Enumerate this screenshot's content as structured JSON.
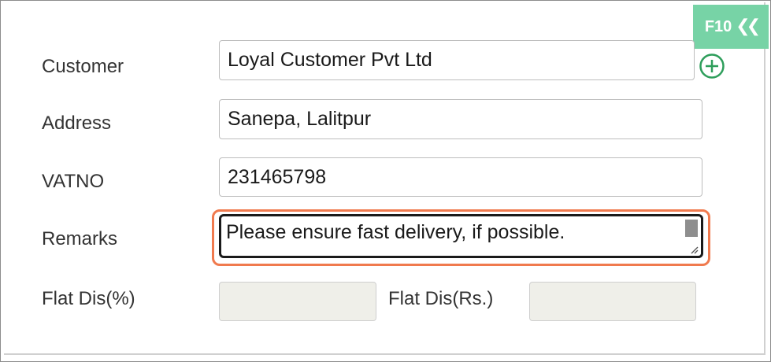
{
  "shortcut": {
    "label": "F10",
    "icon": "double-chevron-left-icon",
    "color": "#77d3a6"
  },
  "form": {
    "customer": {
      "label": "Customer",
      "value": "Loyal Customer Pvt Ltd",
      "add_icon": "plus-circle-icon"
    },
    "address": {
      "label": "Address",
      "value": "Sanepa, Lalitpur"
    },
    "vatno": {
      "label": "VATNO",
      "value": "231465798"
    },
    "remarks": {
      "label": "Remarks",
      "value": "Please ensure fast delivery, if possible.",
      "highlight_color": "#f07a4e"
    },
    "flat_dis_pct": {
      "label": "Flat Dis(%)",
      "value": ""
    },
    "flat_dis_rs": {
      "label": "Flat Dis(Rs.)",
      "value": ""
    }
  }
}
